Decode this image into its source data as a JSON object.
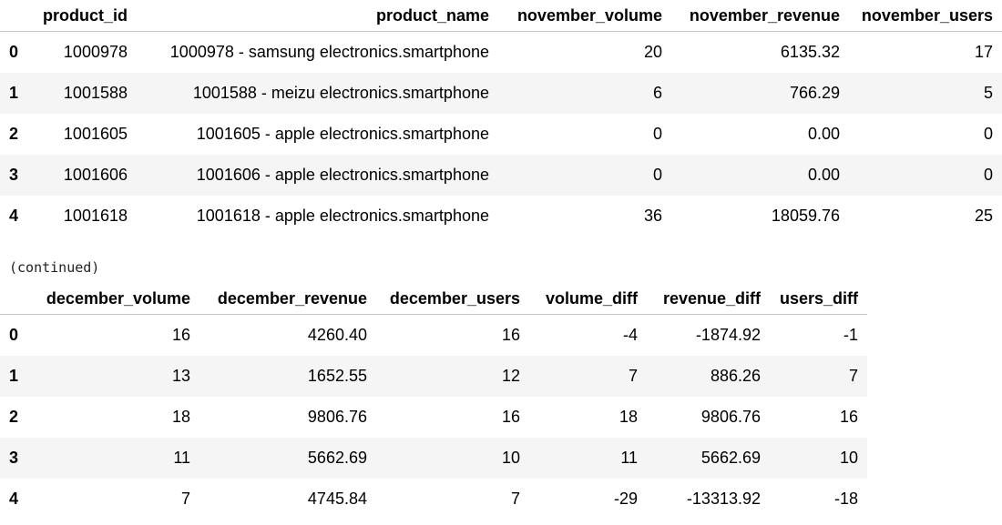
{
  "table1": {
    "index_header": "",
    "columns": [
      "product_id",
      "product_name",
      "november_volume",
      "november_revenue",
      "november_users"
    ],
    "rows": [
      {
        "index": "0",
        "cells": [
          "1000978",
          "1000978 - samsung electronics.smartphone",
          "20",
          "6135.32",
          "17"
        ]
      },
      {
        "index": "1",
        "cells": [
          "1001588",
          "1001588 - meizu electronics.smartphone",
          "6",
          "766.29",
          "5"
        ]
      },
      {
        "index": "2",
        "cells": [
          "1001605",
          "1001605 - apple electronics.smartphone",
          "0",
          "0.00",
          "0"
        ]
      },
      {
        "index": "3",
        "cells": [
          "1001606",
          "1001606 - apple electronics.smartphone",
          "0",
          "0.00",
          "0"
        ]
      },
      {
        "index": "4",
        "cells": [
          "1001618",
          "1001618 - apple electronics.smartphone",
          "36",
          "18059.76",
          "25"
        ]
      }
    ]
  },
  "continued_label": "(continued)",
  "table2": {
    "index_header": "",
    "columns": [
      "december_volume",
      "december_revenue",
      "december_users",
      "volume_diff",
      "revenue_diff",
      "users_diff"
    ],
    "rows": [
      {
        "index": "0",
        "cells": [
          "16",
          "4260.40",
          "16",
          "-4",
          "-1874.92",
          "-1"
        ]
      },
      {
        "index": "1",
        "cells": [
          "13",
          "1652.55",
          "12",
          "7",
          "886.26",
          "7"
        ]
      },
      {
        "index": "2",
        "cells": [
          "18",
          "9806.76",
          "16",
          "18",
          "9806.76",
          "16"
        ]
      },
      {
        "index": "3",
        "cells": [
          "11",
          "5662.69",
          "10",
          "11",
          "5662.69",
          "10"
        ]
      },
      {
        "index": "4",
        "cells": [
          "7",
          "4745.84",
          "7",
          "-29",
          "-13313.92",
          "-18"
        ]
      }
    ]
  },
  "colors": {
    "row_stripe": "#f5f5f5",
    "header_rule": "#c9c9c9",
    "text": "#000000"
  }
}
